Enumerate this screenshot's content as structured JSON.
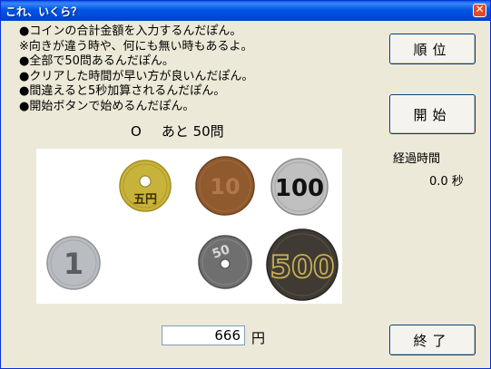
{
  "window": {
    "title": "これ、いくら？",
    "close_symbol": "✕"
  },
  "instructions": [
    "●コインの合計金額を入力するんだぽん。",
    "※向きが違う時や、何にも無い時もあるよ。",
    "●全部で50問あるんだぽん。",
    "●クリアした時間が早い方が良いんだぽん。",
    "●間違えると5秒加算されるんだぽん。",
    "●開始ボタンで始めるんだぽん。"
  ],
  "buttons": {
    "rank": "順位",
    "start": "開始",
    "quit": "終了"
  },
  "status": {
    "mark": "O",
    "remaining": "あと 50問"
  },
  "elapsed": {
    "label": "経過時間",
    "value": "0.0 秒"
  },
  "coins": [
    {
      "name": "5-yen",
      "text": "五円",
      "color": "#c8b33a"
    },
    {
      "name": "10-yen",
      "text": "10",
      "color": "#8e5a2e"
    },
    {
      "name": "100-yen",
      "text": "100",
      "color": "#c0c0c0"
    },
    {
      "name": "1-yen",
      "text": "1",
      "color": "#b9bcc0"
    },
    {
      "name": "50-yen",
      "text": "50",
      "color": "#6f6f6f"
    },
    {
      "name": "500-yen",
      "text": "500",
      "color": "#3f3a33"
    }
  ],
  "answer": {
    "value": "666",
    "unit": "円"
  }
}
